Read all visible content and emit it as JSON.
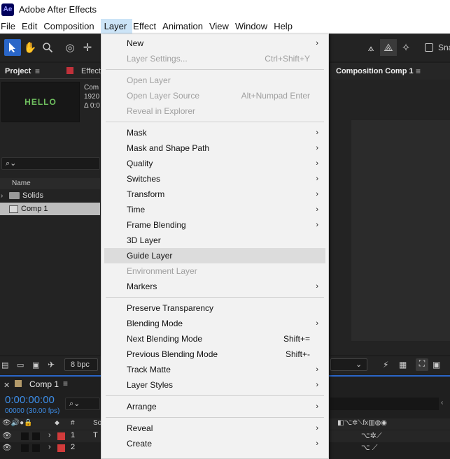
{
  "app": {
    "logo": "Ae",
    "title": "Adobe After Effects"
  },
  "menubar": [
    "File",
    "Edit",
    "Composition",
    "Layer",
    "Effect",
    "Animation",
    "View",
    "Window",
    "Help"
  ],
  "toolbar": {
    "snap_label": "Sna"
  },
  "project": {
    "tab": "Project",
    "effects_tab": "Effect",
    "thumb_text": "HELLO",
    "info_name": "Com",
    "info_res": "1920",
    "info_dur": "Δ 0:0",
    "search_icon": "search-icon",
    "col_name": "Name",
    "items": [
      {
        "label": "Solids",
        "type": "folder"
      },
      {
        "label": "Comp 1",
        "type": "comp"
      }
    ],
    "bpc": "8 bpc"
  },
  "composition": {
    "tab": "Composition Comp 1"
  },
  "timeline": {
    "tab": "Comp 1",
    "timecode": "0:00:00:00",
    "fps": "00000 (30.00 fps)",
    "col_hash": "#",
    "col_source": "So",
    "layers": [
      {
        "num": "1",
        "type": "T",
        "color": "#d13b3b"
      },
      {
        "num": "2",
        "type": "",
        "color": "#d13b3b"
      }
    ]
  },
  "menu": {
    "items": [
      {
        "label": "New",
        "shortcut": "",
        "submenu": true,
        "disabled": false
      },
      {
        "label": "Layer Settings...",
        "shortcut": "Ctrl+Shift+Y",
        "submenu": false,
        "disabled": true
      },
      {
        "sep": true
      },
      {
        "label": "Open Layer",
        "shortcut": "",
        "submenu": false,
        "disabled": true
      },
      {
        "label": "Open Layer Source",
        "shortcut": "Alt+Numpad Enter",
        "submenu": false,
        "disabled": true
      },
      {
        "label": "Reveal in Explorer",
        "shortcut": "",
        "submenu": false,
        "disabled": true
      },
      {
        "sep": true
      },
      {
        "label": "Mask",
        "shortcut": "",
        "submenu": true,
        "disabled": false
      },
      {
        "label": "Mask and Shape Path",
        "shortcut": "",
        "submenu": true,
        "disabled": false
      },
      {
        "label": "Quality",
        "shortcut": "",
        "submenu": true,
        "disabled": false
      },
      {
        "label": "Switches",
        "shortcut": "",
        "submenu": true,
        "disabled": false
      },
      {
        "label": "Transform",
        "shortcut": "",
        "submenu": true,
        "disabled": false
      },
      {
        "label": "Time",
        "shortcut": "",
        "submenu": true,
        "disabled": false
      },
      {
        "label": "Frame Blending",
        "shortcut": "",
        "submenu": true,
        "disabled": false
      },
      {
        "label": "3D Layer",
        "shortcut": "",
        "submenu": false,
        "disabled": false
      },
      {
        "label": "Guide Layer",
        "shortcut": "",
        "submenu": false,
        "disabled": false,
        "hover": true
      },
      {
        "label": "Environment Layer",
        "shortcut": "",
        "submenu": false,
        "disabled": true
      },
      {
        "label": "Markers",
        "shortcut": "",
        "submenu": true,
        "disabled": false
      },
      {
        "sep": true
      },
      {
        "label": "Preserve Transparency",
        "shortcut": "",
        "submenu": false,
        "disabled": false
      },
      {
        "label": "Blending Mode",
        "shortcut": "",
        "submenu": true,
        "disabled": false
      },
      {
        "label": "Next Blending Mode",
        "shortcut": "Shift+=",
        "submenu": false,
        "disabled": false
      },
      {
        "label": "Previous Blending Mode",
        "shortcut": "Shift+-",
        "submenu": false,
        "disabled": false
      },
      {
        "label": "Track Matte",
        "shortcut": "",
        "submenu": true,
        "disabled": false
      },
      {
        "label": "Layer Styles",
        "shortcut": "",
        "submenu": true,
        "disabled": false
      },
      {
        "sep": true
      },
      {
        "label": "Arrange",
        "shortcut": "",
        "submenu": true,
        "disabled": false
      },
      {
        "sep": true
      },
      {
        "label": "Reveal",
        "shortcut": "",
        "submenu": true,
        "disabled": false
      },
      {
        "label": "Create",
        "shortcut": "",
        "submenu": true,
        "disabled": false
      }
    ]
  },
  "colors": {
    "accent": "#2a66c8",
    "timecode": "#3d8ee8",
    "hover": "#dcdcdc",
    "menu_bg": "#f2f2f2"
  }
}
